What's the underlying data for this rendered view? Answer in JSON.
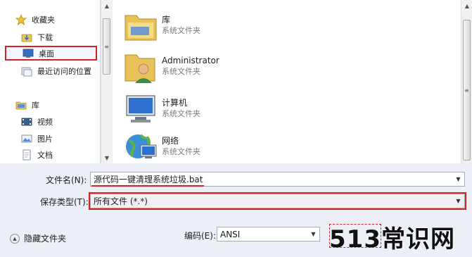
{
  "nav": {
    "items": [
      {
        "label": "收藏夹",
        "icon": "star-icon"
      },
      {
        "label": "下载",
        "icon": "download-folder-icon"
      },
      {
        "label": "桌面",
        "icon": "desktop-icon"
      },
      {
        "label": "最近访问的位置",
        "icon": "recent-places-icon"
      },
      {
        "label": "库",
        "icon": "library-icon"
      },
      {
        "label": "视频",
        "icon": "video-icon"
      },
      {
        "label": "图片",
        "icon": "pictures-icon"
      },
      {
        "label": "文档",
        "icon": "documents-icon"
      }
    ]
  },
  "files": {
    "items": [
      {
        "name": "库",
        "type": "系统文件夹",
        "icon": "library-folder-icon"
      },
      {
        "name": "Administrator",
        "type": "系统文件夹",
        "icon": "user-folder-icon"
      },
      {
        "name": "计算机",
        "type": "系统文件夹",
        "icon": "computer-icon"
      },
      {
        "name": "网络",
        "type": "系统文件夹",
        "icon": "network-icon"
      }
    ]
  },
  "form": {
    "filename_label": "文件名(N):",
    "filename_value": "源代码一键清理系统垃圾.bat",
    "savetype_label": "保存类型(T):",
    "savetype_value": "所有文件  (*.*)",
    "encoding_label": "编码(E):",
    "encoding_value": "ANSI",
    "hide_folders_label": "隐藏文件夹"
  },
  "watermark": "513常识网",
  "colors": {
    "highlight": "#d42323",
    "accent": "#3a7bd5"
  }
}
